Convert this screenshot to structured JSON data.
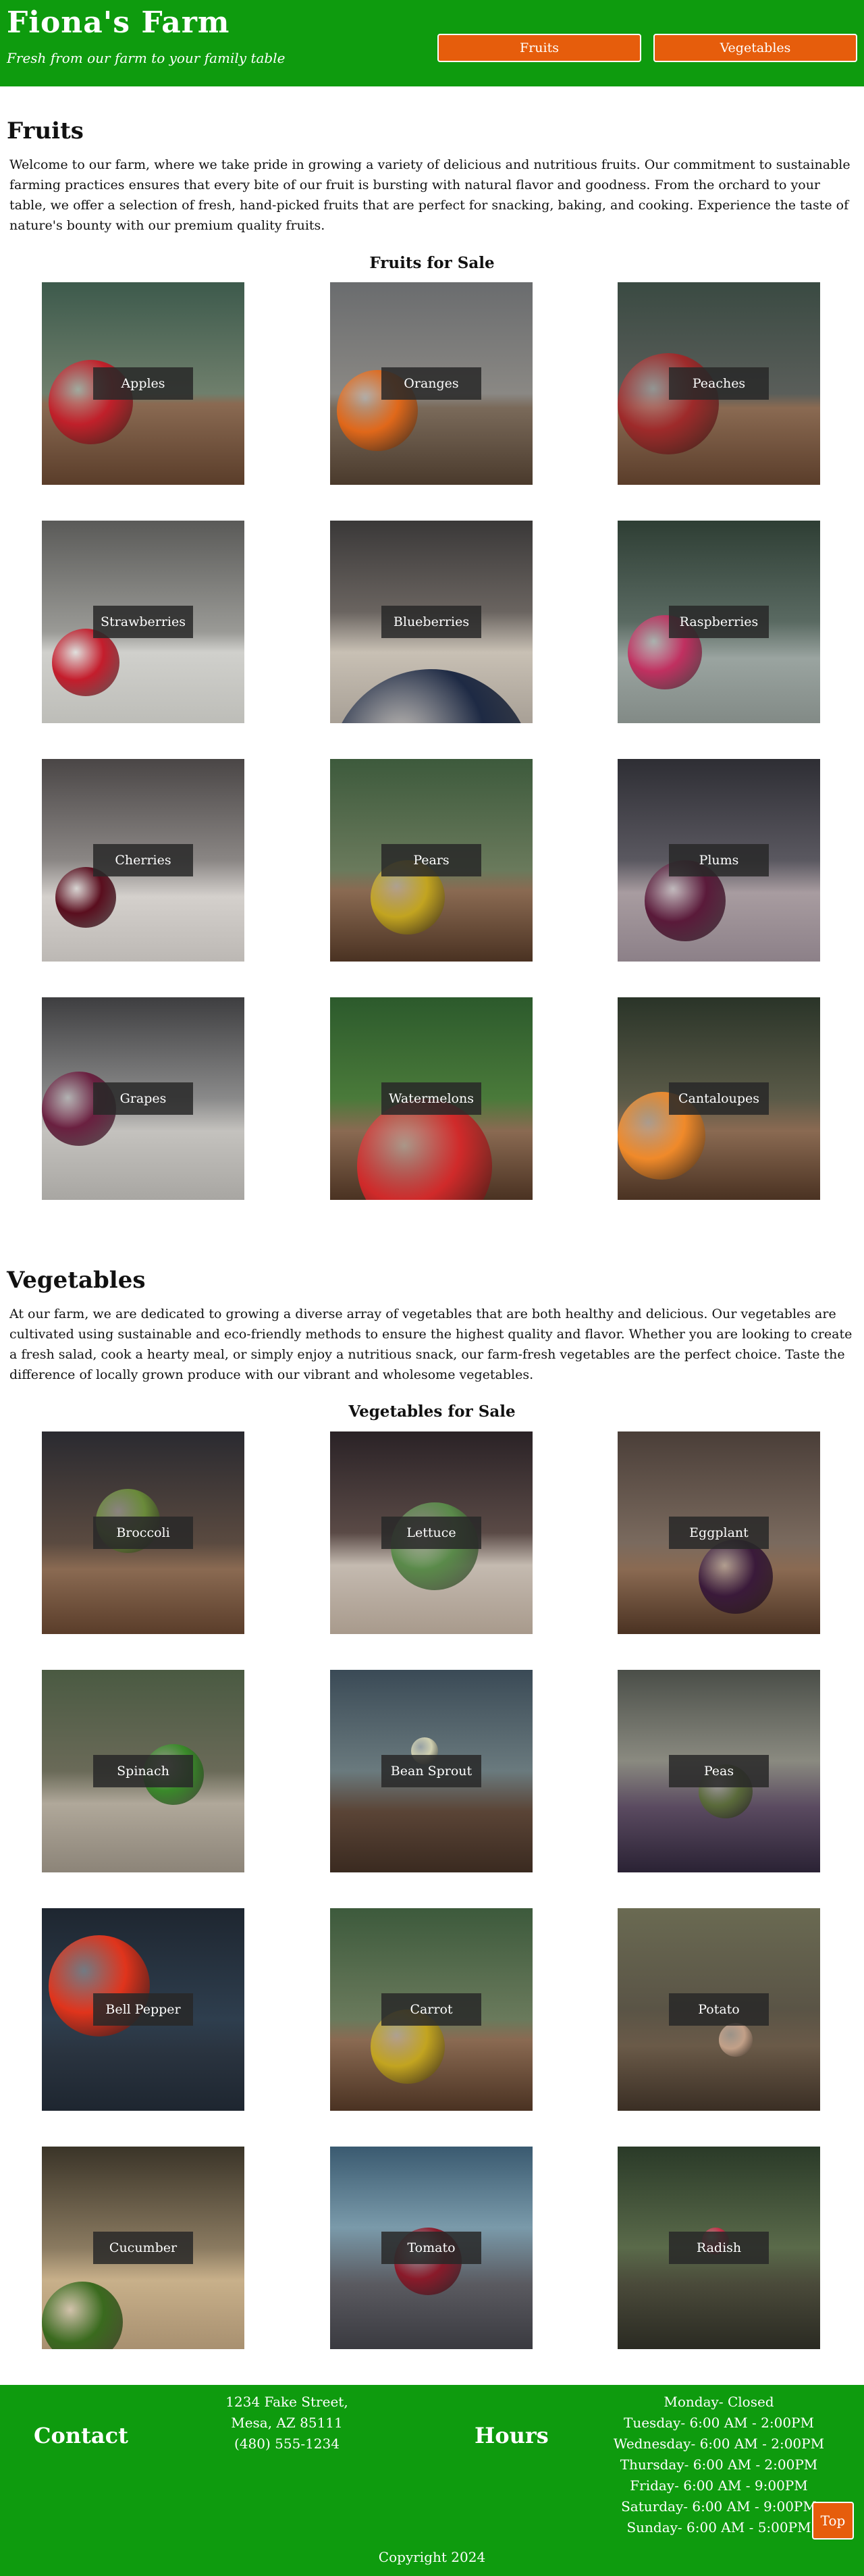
{
  "header": {
    "title": "Fiona's Farm",
    "tagline": "Fresh from our farm to your family table",
    "nav": {
      "fruits_label": "Fruits",
      "vegetables_label": "Vegetables"
    }
  },
  "fruits": {
    "heading": "Fruits",
    "description": "Welcome to our farm, where we take pride in growing a variety of delicious and nutritious fruits. Our commitment to sustainable farming practices ensures that every bite of our fruit is bursting with natural flavor and goodness. From the orchard to your table, we offer a selection of fresh, hand-picked fruits that are perfect for snacking, baking, and cooking. Experience the taste of nature's bounty with our premium quality fruits.",
    "subheading": "Fruits for Sale",
    "items": [
      "Apples",
      "Oranges",
      "Peaches",
      "Strawberries",
      "Blueberries",
      "Raspberries",
      "Cherries",
      "Pears",
      "Plums",
      "Grapes",
      "Watermelons",
      "Cantaloupes"
    ]
  },
  "vegetables": {
    "heading": "Vegetables",
    "description": "At our farm, we are dedicated to growing a diverse array of vegetables that are both healthy and delicious. Our vegetables are cultivated using sustainable and eco-friendly methods to ensure the highest quality and flavor. Whether you are looking to create a fresh salad, cook a hearty meal, or simply enjoy a nutritious snack, our farm-fresh vegetables are the perfect choice. Taste the difference of locally grown produce with our vibrant and wholesome vegetables.",
    "subheading": "Vegetables for Sale",
    "items": [
      "Broccoli",
      "Lettuce",
      "Eggplant",
      "Spinach",
      "Bean Sprout",
      "Peas",
      "Bell Pepper",
      "Carrot",
      "Potato",
      "Cucumber",
      "Tomato",
      "Radish"
    ]
  },
  "footer": {
    "contact_heading": "Contact",
    "address_line1": "1234 Fake Street,",
    "address_line2": "Mesa, AZ 85111",
    "phone": "(480) 555-1234",
    "hours_heading": "Hours",
    "hours": [
      "Monday- Closed",
      "Tuesday- 6:00 AM - 2:00PM",
      "Wednesday- 6:00 AM - 2:00PM",
      "Thursday- 6:00 AM - 2:00PM",
      "Friday- 6:00 AM - 9:00PM",
      "Saturday- 6:00 AM - 9:00PM",
      "Sunday- 6:00 AM - 5:00PM"
    ],
    "copyright": "Copyright 2024",
    "top_label": "Top"
  },
  "colors": {
    "brand_green": "#0e9b0e",
    "accent_orange": "#e65d0c"
  }
}
